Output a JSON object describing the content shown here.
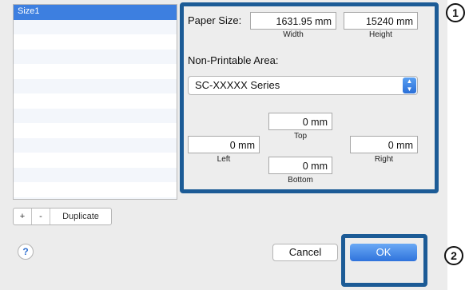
{
  "size_list": {
    "items": [
      "Size1",
      "",
      "",
      "",
      "",
      "",
      "",
      "",
      "",
      "",
      "",
      "",
      "",
      ""
    ],
    "selected_index": 0
  },
  "list_buttons": {
    "add": "+",
    "remove": "-",
    "duplicate": "Duplicate"
  },
  "paper_size": {
    "label": "Paper Size:",
    "width_value": "1631.95 mm",
    "width_label": "Width",
    "height_value": "15240 mm",
    "height_label": "Height"
  },
  "non_printable": {
    "label": "Non-Printable Area:",
    "printer": "SC-XXXXX Series",
    "top_value": "0 mm",
    "top_label": "Top",
    "left_value": "0 mm",
    "left_label": "Left",
    "right_value": "0 mm",
    "right_label": "Right",
    "bottom_value": "0 mm",
    "bottom_label": "Bottom"
  },
  "footer": {
    "help": "?",
    "cancel": "Cancel",
    "ok": "OK"
  },
  "callouts": {
    "one": "1",
    "two": "2"
  },
  "colors": {
    "highlight_frame": "#1c5b96",
    "selection": "#3d7fe0",
    "ok_button": "#2f73dc"
  }
}
